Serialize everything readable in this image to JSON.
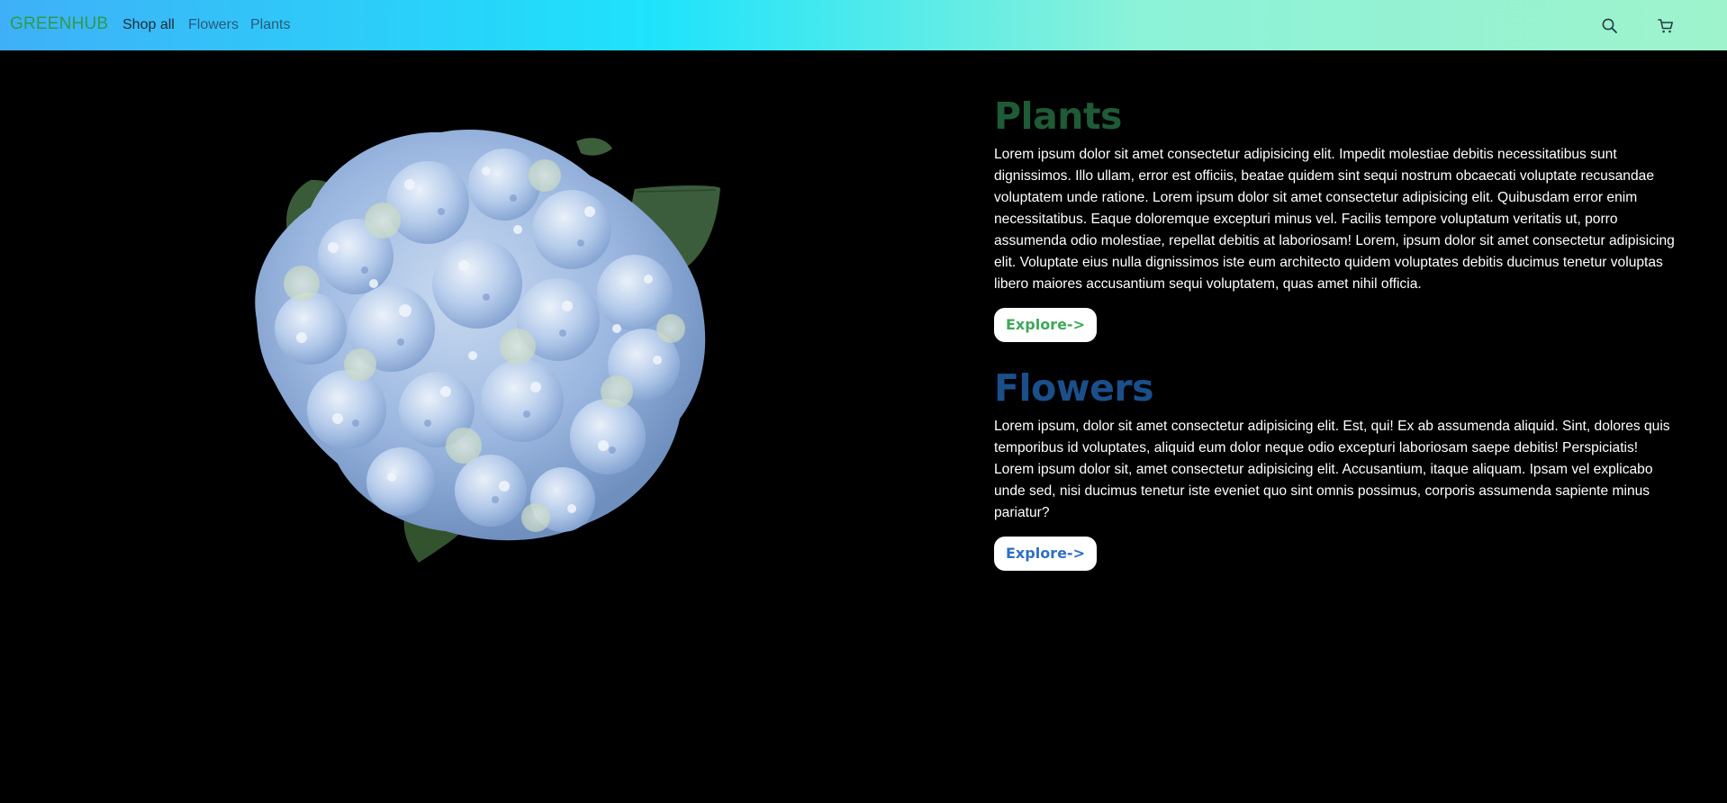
{
  "nav": {
    "brand": "GREENHUB",
    "links": [
      "Shop all",
      "Flowers",
      "Plants"
    ],
    "icons": [
      "search-icon",
      "cart-icon"
    ]
  },
  "hero": {
    "image": "blue-hydrangea-bouquet"
  },
  "sections": {
    "plants": {
      "title": "Plants",
      "body": "Lorem ipsum dolor sit amet consectetur adipisicing elit. Impedit molestiae debitis necessitatibus sunt dignissimos. Illo ullam, error est officiis, beatae quidem sint sequi nostrum obcaecati voluptate recusandae voluptatem unde ratione. Lorem ipsum dolor sit amet consectetur adipisicing elit. Quibusdam error enim necessitatibus. Eaque doloremque excepturi minus vel. Facilis tempore voluptatum veritatis ut, porro assumenda odio molestiae, repellat debitis at laboriosam! Lorem, ipsum dolor sit amet consectetur adipisicing elit. Voluptate eius nulla dignissimos iste eum architecto quidem voluptates debitis ducimus tenetur voluptas libero maiores accusantium sequi voluptatem, quas amet nihil officia.",
      "button": "Explore->"
    },
    "flowers": {
      "title": "Flowers",
      "body": "Lorem ipsum, dolor sit amet consectetur adipisicing elit. Est, qui! Ex ab assumenda aliquid. Sint, dolores quis temporibus id voluptates, aliquid eum dolor neque odio excepturi laboriosam saepe debitis! Perspiciatis! Lorem ipsum dolor sit, amet consectetur adipisicing elit. Accusantium, itaque aliquam. Ipsam vel explicabo unde sed, nisi ducimus tenetur iste eveniet quo sint omnis possimus, corporis assumenda sapiente minus pariatur?",
      "button": "Explore->"
    }
  },
  "colors": {
    "nav_gradient_start": "#3fb0f7",
    "nav_gradient_mid": "#1ee3fb",
    "nav_gradient_end": "#9ef3cc",
    "brand": "#2f9a4e",
    "plants_title": "#1e5b36",
    "flowers_title": "#1a4f8a",
    "plants_button_text": "#3fa85a",
    "flowers_button_text": "#2f6fc4",
    "background": "#000000"
  }
}
